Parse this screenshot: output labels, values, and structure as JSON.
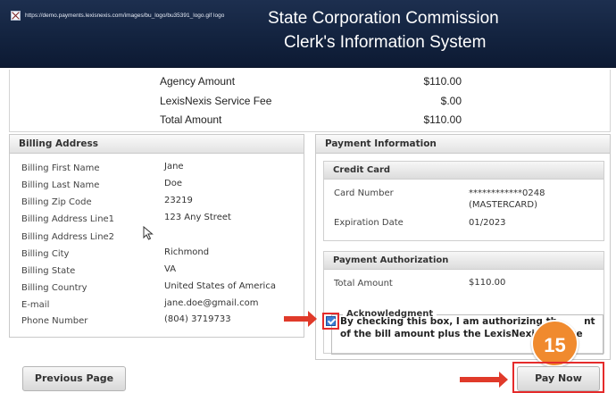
{
  "header": {
    "broken_logo_alt": "https://demo.payments.lexisnexis.com/images/bu_logo/bu35391_logo.gif logo",
    "title_line1": "State Corporation Commission",
    "title_line2": "Clerk's Information System"
  },
  "amounts": [
    {
      "label": "Agency Amount",
      "value": "$110.00"
    },
    {
      "label": "LexisNexis Service Fee",
      "value": "$.00"
    },
    {
      "label": "Total Amount",
      "value": "$110.00"
    }
  ],
  "billing": {
    "title": "Billing Address",
    "fields": [
      {
        "label": "Billing First Name",
        "value": "Jane"
      },
      {
        "label": "Billing Last Name",
        "value": "Doe"
      },
      {
        "label": "Billing Zip Code",
        "value": "23219"
      },
      {
        "label": "Billing Address Line1",
        "value": "123 Any Street"
      },
      {
        "label": "Billing Address Line2",
        "value": ""
      },
      {
        "label": "Billing City",
        "value": "Richmond"
      },
      {
        "label": "Billing State",
        "value": "VA"
      },
      {
        "label": "Billing Country",
        "value": "United States of America"
      },
      {
        "label": "E-mail",
        "value": "jane.doe@gmail.com"
      },
      {
        "label": "Phone Number",
        "value": "(804) 3719733"
      }
    ]
  },
  "payment": {
    "title": "Payment Information",
    "credit_card": {
      "title": "Credit Card",
      "card_number_label": "Card Number",
      "card_number_value": "************0248",
      "card_type": "(MASTERCARD)",
      "expiration_label": "Expiration Date",
      "expiration_value": "01/2023"
    },
    "authorization": {
      "title": "Payment Authorization",
      "total_label": "Total Amount",
      "total_value": "$110.00",
      "ack_legend": "Acknowledgment",
      "ack_text_part1": "By checking this box, I am authorizing th",
      "ack_text_part2": "nt of the bill amount plus the LexisNexis Service",
      "ack_checked": true
    }
  },
  "step_badge": "15",
  "buttons": {
    "previous": "Previous Page",
    "pay_now": "Pay Now"
  },
  "colors": {
    "header_bg": "#13233f",
    "annotation_red": "#e03a2a",
    "badge_orange": "#f08a2e"
  }
}
